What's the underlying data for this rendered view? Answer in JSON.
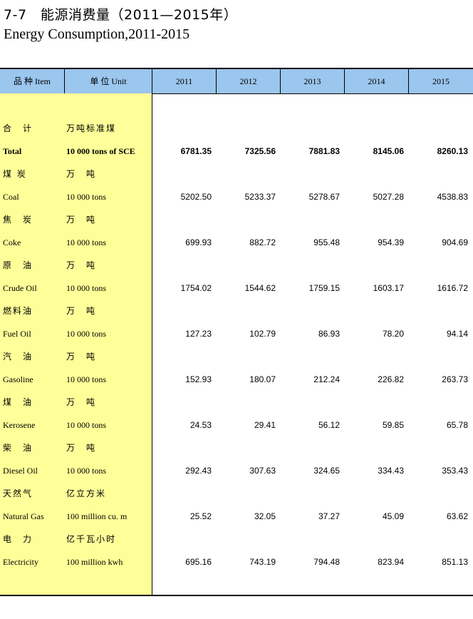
{
  "title": {
    "cn": "7-7　能源消费量（2011—2015年）",
    "en": "Energy Consumption,2011-2015"
  },
  "header": {
    "item": "品  种  Item",
    "unit": "单  位  Unit",
    "years": [
      "2011",
      "2012",
      "2013",
      "2014",
      "2015"
    ]
  },
  "rows": [
    {
      "cn": "合　计",
      "unit_cn": "万吨标准煤",
      "en": "Total",
      "unit_en": "10 000 tons of SCE",
      "values": [
        "6781.35",
        "7325.56",
        "7881.83",
        "8145.06",
        "8260.13"
      ],
      "bold": true
    },
    {
      "cn": "煤 炭",
      "unit_cn": "万　吨",
      "en": "Coal",
      "unit_en": "10 000 tons",
      "values": [
        "5202.50",
        "5233.37",
        "5278.67",
        "5027.28",
        "4538.83"
      ]
    },
    {
      "cn": "焦　炭",
      "unit_cn": "万　吨",
      "en": "Coke",
      "unit_en": "10 000 tons",
      "values": [
        "699.93",
        "882.72",
        "955.48",
        "954.39",
        "904.69"
      ]
    },
    {
      "cn": "原　油",
      "unit_cn": "万　吨",
      "en": "Crude Oil",
      "unit_en": "10 000 tons",
      "values": [
        "1754.02",
        "1544.62",
        "1759.15",
        "1603.17",
        "1616.72"
      ]
    },
    {
      "cn": "燃料油",
      "unit_cn": "万　吨",
      "en": "Fuel Oil",
      "unit_en": "10 000 tons",
      "values": [
        "127.23",
        "102.79",
        "86.93",
        "78.20",
        "94.14"
      ]
    },
    {
      "cn": "汽　油",
      "unit_cn": "万　吨",
      "en": "Gasoline",
      "unit_en": "10 000 tons",
      "values": [
        "152.93",
        "180.07",
        "212.24",
        "226.82",
        "263.73"
      ]
    },
    {
      "cn": "煤　油",
      "unit_cn": "万　吨",
      "en": "Kerosene",
      "unit_en": "10 000 tons",
      "values": [
        "24.53",
        "29.41",
        "56.12",
        "59.85",
        "65.78"
      ]
    },
    {
      "cn": "柴　油",
      "unit_cn": "万　吨",
      "en": "Diesel Oil",
      "unit_en": "10 000 tons",
      "values": [
        "292.43",
        "307.63",
        "324.65",
        "334.43",
        "353.43"
      ]
    },
    {
      "cn": "天然气",
      "unit_cn": "亿立方米",
      "en": "Natural Gas",
      "unit_en": "100 million cu. m",
      "values": [
        "25.52",
        "32.05",
        "37.27",
        "45.09",
        "63.62"
      ]
    },
    {
      "cn": "电　力",
      "unit_cn": "亿千瓦小时",
      "en": "Electricity",
      "unit_en": "100 million kwh",
      "values": [
        "695.16",
        "743.19",
        "794.48",
        "823.94",
        "851.13"
      ]
    }
  ]
}
